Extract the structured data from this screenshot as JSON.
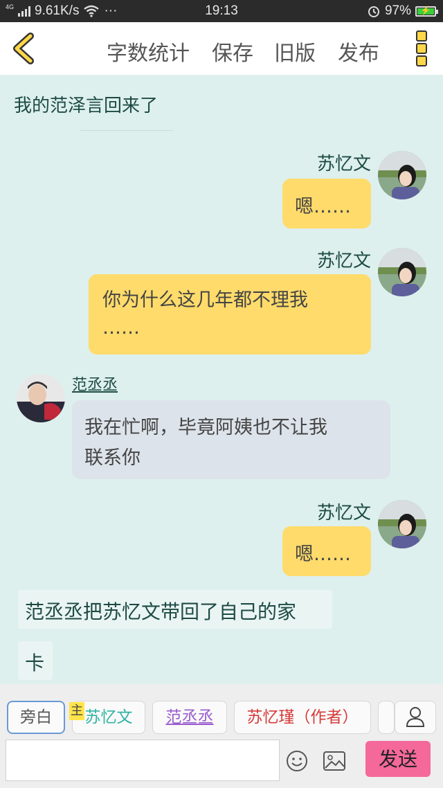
{
  "status_bar": {
    "net_tag": "4G",
    "speed": "9.61K/s",
    "more": "···",
    "time": "19:13",
    "alarm_icon": "alarm-icon",
    "battery": "97%",
    "battery_level": 0.97
  },
  "header": {
    "back_icon": "chevron-left-icon",
    "items": [
      "字数统计",
      "保存",
      "旧版",
      "发布"
    ],
    "more_icon": "more-vertical-icon"
  },
  "chat": {
    "title": "我的范泽言回来了",
    "messages": [
      {
        "side": "right",
        "name": "苏忆文",
        "text": "嗯……"
      },
      {
        "side": "right",
        "name": "苏忆文",
        "text_line1": "你为什么这几年都不理我",
        "text_line2": "……"
      },
      {
        "side": "left",
        "name": "范丞丞",
        "text_line1": "我在忙啊，毕竟阿姨也不让我",
        "text_line2": "联系你"
      },
      {
        "side": "right",
        "name": "苏忆文",
        "text": "嗯……"
      }
    ],
    "narrations": [
      "范丞丞把苏忆文带回了自己的家",
      "卡"
    ]
  },
  "roles": {
    "narrator": "旁白",
    "main_badge": "主",
    "role1": "苏忆文",
    "role2": "范丞丞",
    "role3": "苏忆瑾（作者）"
  },
  "composer": {
    "input_value": "",
    "send_label": "发送"
  },
  "colors": {
    "background": "#ddf0ee",
    "bubble_yellow": "#fedb6b",
    "bubble_gray": "#dde3ea",
    "send_pink": "#f5689a",
    "accent_dark_green": "#1e4a44"
  }
}
